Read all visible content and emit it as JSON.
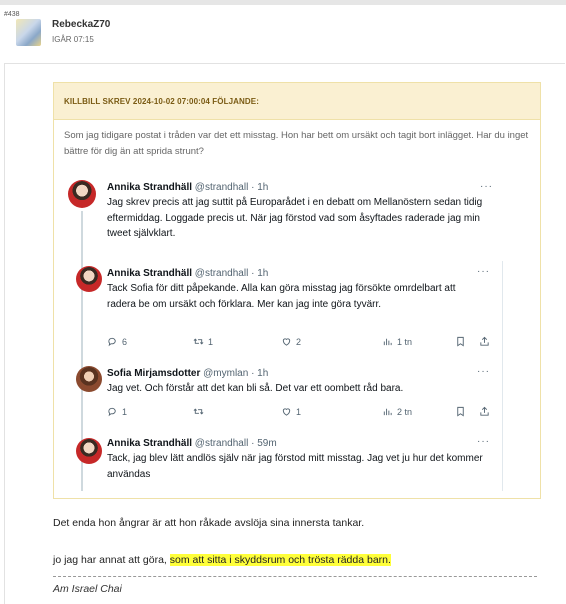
{
  "post": {
    "number": "#438",
    "username": "RebeckaZ70",
    "time": "IGÅR 07:15"
  },
  "quote": {
    "header": "KILLBILL SKREV 2024-10-02 07:00:04 FÖLJANDE:",
    "text": "Som jag tidigare postat i tråden var det ett misstag. Hon har bett om ursäkt och tagit bort inlägget. Har du inget bättre för dig än att sprida strunt?"
  },
  "tweets": [
    {
      "name": "Annika Strandhäll",
      "handle": "@strandhall · 1h",
      "more": "···",
      "text": "Jag skrev precis att jag suttit på Europarådet i en debatt om Mellanöstern sedan tidig eftermiddag. Loggade precis ut. När jag förstod vad som åsyftades raderade jag min tweet självklart."
    },
    {
      "name": "Annika Strandhäll",
      "handle": "@strandhall · 1h",
      "more": "···",
      "text": "Tack Sofia för ditt påpekande. Alla kan göra misstag jag försökte omrdelbart att radera be om ursäkt och förklara. Mer kan jag inte göra tyvärr.",
      "replies": "6",
      "retweets": "1",
      "likes": "2",
      "views": "1 tn"
    },
    {
      "name": "Sofia Mirjamsdotter",
      "handle": "@mymlan · 1h",
      "more": "···",
      "text": "Jag vet. Och förstår att det kan bli så. Det var ett oombett råd bara.",
      "replies": "1",
      "retweets": "",
      "likes": "1",
      "views": "2 tn"
    },
    {
      "name": "Annika Strandhäll",
      "handle": "@strandhall · 59m",
      "more": "···",
      "text": "Tack, jag blev lätt andlös själv när jag förstod mitt misstag. Jag vet ju hur det kommer användas"
    }
  ],
  "body": {
    "line1": "Det enda hon ångrar är att hon råkade avslöja sina innersta tankar.",
    "line2_plain": "jo jag har annat att göra, ",
    "line2_highlight": "som att sitta i skyddsrum och trösta rädda barn.",
    "signature": "Am Israel Chai"
  },
  "colors": {
    "quote_header_bg": "#faf0d2",
    "quote_header_text": "#7a5b14",
    "highlight": "#ffff3a"
  },
  "icons": [
    "reply-icon",
    "retweet-icon",
    "like-icon",
    "views-icon",
    "bookmark-icon",
    "share-icon",
    "more-icon"
  ]
}
